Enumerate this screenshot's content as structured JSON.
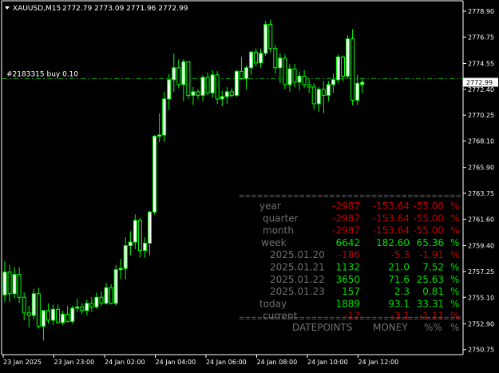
{
  "header": {
    "symbol": "XAUUSD,M15",
    "ohlc": "2772.79 2773.09 2771.96 2772.99"
  },
  "order_line": {
    "label": "#2183315 buy 0.10",
    "price": 2773.3
  },
  "current_price": {
    "label": "2772.99",
    "value": 2772.99
  },
  "price_axis": {
    "ticks": [
      {
        "label": "2778.90",
        "value": 2778.9
      },
      {
        "label": "2776.75",
        "value": 2776.75
      },
      {
        "label": "2774.55",
        "value": 2774.55
      },
      {
        "label": "2772.40",
        "value": 2772.4
      },
      {
        "label": "2770.25",
        "value": 2770.25
      },
      {
        "label": "2768.10",
        "value": 2768.1
      },
      {
        "label": "2765.90",
        "value": 2765.9
      },
      {
        "label": "2763.75",
        "value": 2763.75
      },
      {
        "label": "2761.60",
        "value": 2761.6
      },
      {
        "label": "2759.40",
        "value": 2759.4
      },
      {
        "label": "2757.25",
        "value": 2757.25
      },
      {
        "label": "2755.10",
        "value": 2755.1
      },
      {
        "label": "2752.90",
        "value": 2752.9
      },
      {
        "label": "2750.75",
        "value": 2750.75
      }
    ]
  },
  "time_axis": {
    "labels": [
      "23 Jan 2025",
      "23 Jan 23:00",
      "24 Jan 02:00",
      "24 Jan 04:00",
      "24 Jan 06:00",
      "24 Jan 08:00",
      "24 Jan 10:00",
      "24 Jan 12:00"
    ]
  },
  "colors": {
    "background": "#000000",
    "up_candle": "#ffffff",
    "down_candle": "#000000",
    "wick": "#00ff00",
    "order_line": "#00aa00",
    "positive": "#00dd00",
    "negative": "#c00000",
    "label_gray": "#6f6f6f"
  },
  "stats": {
    "separator": "=====================================",
    "rows": [
      {
        "label": "year",
        "points": "-2987",
        "money": "-153.64",
        "pct": "-55.00",
        "sign": "%",
        "positive": false
      },
      {
        "label": "quarter",
        "points": "-2987",
        "money": "-153.64",
        "pct": "-55.00",
        "sign": "%",
        "positive": false
      },
      {
        "label": "month",
        "points": "-2987",
        "money": "-153.64",
        "pct": "-55.00",
        "sign": "%",
        "positive": false
      },
      {
        "label": "week",
        "points": "6642",
        "money": "182.60",
        "pct": "65.36",
        "sign": "%",
        "positive": true
      },
      {
        "label": "2025.01.20",
        "points": "-186",
        "money": "-5.3",
        "pct": "-1.91",
        "sign": "%",
        "positive": false
      },
      {
        "label": "2025.01.21",
        "points": "1132",
        "money": "21.0",
        "pct": "7.52",
        "sign": "%",
        "positive": true
      },
      {
        "label": "2025.01.22",
        "points": "3650",
        "money": "71.6",
        "pct": "25.63",
        "sign": "%",
        "positive": true
      },
      {
        "label": "2025.01.23",
        "points": "157",
        "money": "2.3",
        "pct": "0.81",
        "sign": "%",
        "positive": true
      },
      {
        "label": "today",
        "points": "1889",
        "money": "93.1",
        "pct": "33.31",
        "sign": "%",
        "positive": true
      },
      {
        "label": "current",
        "points": "-17",
        "money": "-3.1",
        "pct": "-1.11",
        "sign": "%",
        "positive": false
      }
    ],
    "footer": {
      "date_points": "DATEPOINTS",
      "money": "MONEY",
      "pct": "%%",
      "sign": "%"
    }
  },
  "chart_data": {
    "type": "candlestick",
    "ylim": [
      2750.4,
      2779.7
    ],
    "candles": [
      {
        "o": 2755.3,
        "h": 2758.1,
        "l": 2754.7,
        "c": 2757.2
      },
      {
        "o": 2757.2,
        "h": 2757.8,
        "l": 2754.7,
        "c": 2755.4
      },
      {
        "o": 2755.4,
        "h": 2757.6,
        "l": 2755.0,
        "c": 2757.0
      },
      {
        "o": 2757.0,
        "h": 2757.6,
        "l": 2754.6,
        "c": 2755.1
      },
      {
        "o": 2755.1,
        "h": 2755.5,
        "l": 2753.2,
        "c": 2753.8
      },
      {
        "o": 2753.8,
        "h": 2754.4,
        "l": 2752.6,
        "c": 2753.6
      },
      {
        "o": 2753.6,
        "h": 2755.8,
        "l": 2753.3,
        "c": 2755.4
      },
      {
        "o": 2755.4,
        "h": 2755.9,
        "l": 2752.5,
        "c": 2752.7
      },
      {
        "o": 2752.7,
        "h": 2754.0,
        "l": 2751.5,
        "c": 2754.0
      },
      {
        "o": 2754.0,
        "h": 2754.6,
        "l": 2752.9,
        "c": 2753.2
      },
      {
        "o": 2753.2,
        "h": 2754.5,
        "l": 2752.8,
        "c": 2754.1
      },
      {
        "o": 2754.1,
        "h": 2754.5,
        "l": 2752.9,
        "c": 2753.0
      },
      {
        "o": 2753.0,
        "h": 2754.0,
        "l": 2752.8,
        "c": 2753.7
      },
      {
        "o": 2753.7,
        "h": 2754.4,
        "l": 2753.0,
        "c": 2753.1
      },
      {
        "o": 2753.1,
        "h": 2754.4,
        "l": 2752.9,
        "c": 2754.2
      },
      {
        "o": 2754.2,
        "h": 2755.0,
        "l": 2753.9,
        "c": 2754.3
      },
      {
        "o": 2754.3,
        "h": 2754.6,
        "l": 2753.7,
        "c": 2754.0
      },
      {
        "o": 2754.0,
        "h": 2754.9,
        "l": 2753.6,
        "c": 2754.6
      },
      {
        "o": 2754.6,
        "h": 2755.1,
        "l": 2753.9,
        "c": 2754.3
      },
      {
        "o": 2754.3,
        "h": 2755.5,
        "l": 2754.1,
        "c": 2755.1
      },
      {
        "o": 2755.1,
        "h": 2755.6,
        "l": 2754.4,
        "c": 2754.6
      },
      {
        "o": 2754.6,
        "h": 2756.3,
        "l": 2754.5,
        "c": 2755.9
      },
      {
        "o": 2755.9,
        "h": 2756.2,
        "l": 2754.5,
        "c": 2754.6
      },
      {
        "o": 2754.6,
        "h": 2757.8,
        "l": 2754.4,
        "c": 2757.4
      },
      {
        "o": 2757.4,
        "h": 2758.3,
        "l": 2756.6,
        "c": 2757.5
      },
      {
        "o": 2757.5,
        "h": 2760.1,
        "l": 2756.6,
        "c": 2759.4
      },
      {
        "o": 2759.4,
        "h": 2760.6,
        "l": 2758.6,
        "c": 2759.7
      },
      {
        "o": 2759.7,
        "h": 2762.0,
        "l": 2759.1,
        "c": 2761.5
      },
      {
        "o": 2761.5,
        "h": 2761.7,
        "l": 2758.4,
        "c": 2759.0
      },
      {
        "o": 2759.0,
        "h": 2760.1,
        "l": 2758.4,
        "c": 2759.6
      },
      {
        "o": 2759.6,
        "h": 2762.3,
        "l": 2758.6,
        "c": 2762.2
      },
      {
        "o": 2762.2,
        "h": 2768.6,
        "l": 2762.0,
        "c": 2768.5
      },
      {
        "o": 2768.5,
        "h": 2770.4,
        "l": 2768.0,
        "c": 2768.6
      },
      {
        "o": 2768.6,
        "h": 2772.2,
        "l": 2768.0,
        "c": 2771.6
      },
      {
        "o": 2771.6,
        "h": 2773.7,
        "l": 2770.7,
        "c": 2773.2
      },
      {
        "o": 2773.2,
        "h": 2775.4,
        "l": 2772.2,
        "c": 2774.2
      },
      {
        "o": 2774.2,
        "h": 2774.9,
        "l": 2772.5,
        "c": 2772.8
      },
      {
        "o": 2772.8,
        "h": 2774.9,
        "l": 2771.4,
        "c": 2774.7
      },
      {
        "o": 2774.7,
        "h": 2774.7,
        "l": 2771.6,
        "c": 2771.9
      },
      {
        "o": 2771.9,
        "h": 2772.6,
        "l": 2771.1,
        "c": 2772.2
      },
      {
        "o": 2772.2,
        "h": 2772.4,
        "l": 2771.6,
        "c": 2771.9
      },
      {
        "o": 2771.9,
        "h": 2773.6,
        "l": 2771.4,
        "c": 2773.4
      },
      {
        "o": 2773.4,
        "h": 2773.8,
        "l": 2771.9,
        "c": 2772.1
      },
      {
        "o": 2772.1,
        "h": 2774.0,
        "l": 2771.7,
        "c": 2773.6
      },
      {
        "o": 2773.6,
        "h": 2773.9,
        "l": 2771.2,
        "c": 2771.6
      },
      {
        "o": 2771.6,
        "h": 2772.3,
        "l": 2771.0,
        "c": 2771.8
      },
      {
        "o": 2771.8,
        "h": 2772.6,
        "l": 2771.2,
        "c": 2772.2
      },
      {
        "o": 2772.2,
        "h": 2772.5,
        "l": 2771.7,
        "c": 2771.9
      },
      {
        "o": 2771.9,
        "h": 2774.0,
        "l": 2771.8,
        "c": 2773.9
      },
      {
        "o": 2773.9,
        "h": 2775.1,
        "l": 2773.2,
        "c": 2773.3
      },
      {
        "o": 2773.3,
        "h": 2774.4,
        "l": 2772.4,
        "c": 2774.2
      },
      {
        "o": 2774.2,
        "h": 2775.6,
        "l": 2773.6,
        "c": 2775.5
      },
      {
        "o": 2775.5,
        "h": 2775.8,
        "l": 2774.3,
        "c": 2774.6
      },
      {
        "o": 2774.6,
        "h": 2775.8,
        "l": 2774.2,
        "c": 2775.4
      },
      {
        "o": 2775.4,
        "h": 2778.1,
        "l": 2775.2,
        "c": 2777.8
      },
      {
        "o": 2777.8,
        "h": 2778.2,
        "l": 2775.5,
        "c": 2775.8
      },
      {
        "o": 2775.8,
        "h": 2776.1,
        "l": 2773.7,
        "c": 2774.2
      },
      {
        "o": 2774.2,
        "h": 2775.4,
        "l": 2772.9,
        "c": 2775.0
      },
      {
        "o": 2775.0,
        "h": 2775.3,
        "l": 2772.4,
        "c": 2772.8
      },
      {
        "o": 2772.8,
        "h": 2774.5,
        "l": 2772.2,
        "c": 2774.1
      },
      {
        "o": 2774.1,
        "h": 2774.5,
        "l": 2772.6,
        "c": 2773.0
      },
      {
        "o": 2773.0,
        "h": 2773.9,
        "l": 2772.3,
        "c": 2773.5
      },
      {
        "o": 2773.5,
        "h": 2774.0,
        "l": 2772.5,
        "c": 2772.8
      },
      {
        "o": 2772.8,
        "h": 2773.3,
        "l": 2772.1,
        "c": 2772.6
      },
      {
        "o": 2772.6,
        "h": 2772.9,
        "l": 2770.7,
        "c": 2771.2
      },
      {
        "o": 2771.2,
        "h": 2772.6,
        "l": 2770.5,
        "c": 2772.4
      },
      {
        "o": 2772.4,
        "h": 2773.1,
        "l": 2770.4,
        "c": 2771.9
      },
      {
        "o": 2771.9,
        "h": 2773.1,
        "l": 2771.4,
        "c": 2772.8
      },
      {
        "o": 2772.8,
        "h": 2773.7,
        "l": 2772.1,
        "c": 2773.2
      },
      {
        "o": 2773.2,
        "h": 2775.3,
        "l": 2772.9,
        "c": 2775.1
      },
      {
        "o": 2775.1,
        "h": 2775.2,
        "l": 2773.1,
        "c": 2773.5
      },
      {
        "o": 2773.5,
        "h": 2776.9,
        "l": 2773.3,
        "c": 2776.6
      },
      {
        "o": 2776.6,
        "h": 2777.4,
        "l": 2771.1,
        "c": 2771.5
      },
      {
        "o": 2771.5,
        "h": 2773.6,
        "l": 2771.1,
        "c": 2772.9
      },
      {
        "o": 2772.8,
        "h": 2773.3,
        "l": 2772.1,
        "c": 2772.99
      }
    ]
  }
}
